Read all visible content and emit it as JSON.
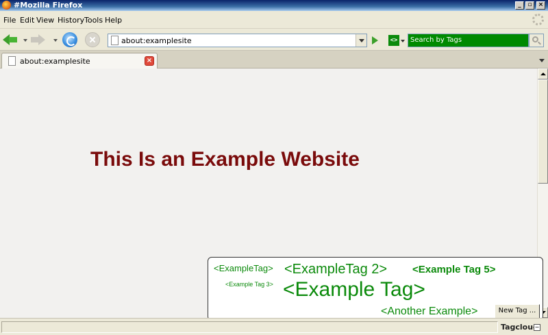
{
  "window": {
    "title": "#Mozilla Firefox",
    "min": "_",
    "max": "▫",
    "close": "×"
  },
  "menu": {
    "items": [
      "File",
      "Edit",
      "View",
      "History",
      "Tools",
      "Help"
    ]
  },
  "nav": {
    "url": "about:examplesite"
  },
  "tag_search": {
    "engine_glyph": "<>",
    "placeholder": "Search by Tags"
  },
  "tabs": [
    {
      "label": "about:examplesite",
      "close": "×"
    }
  ],
  "page": {
    "heading": "This Is an Example Website"
  },
  "tagcloud": {
    "tags": [
      "<ExampleTag>",
      "<ExampleTag 2>",
      "<Example Tag 5>",
      "<Example Tag 3>",
      "<Example Tag>",
      "<Another Example>"
    ],
    "new_tag_label": "New Tag ..."
  },
  "status": {
    "tagcloud_label": "Tagcloud",
    "tagcloud_icon": "−"
  },
  "colors": {
    "heading": "#7a0b0b",
    "tag_green": "#0b8a0b",
    "search_bg": "#008a00"
  }
}
